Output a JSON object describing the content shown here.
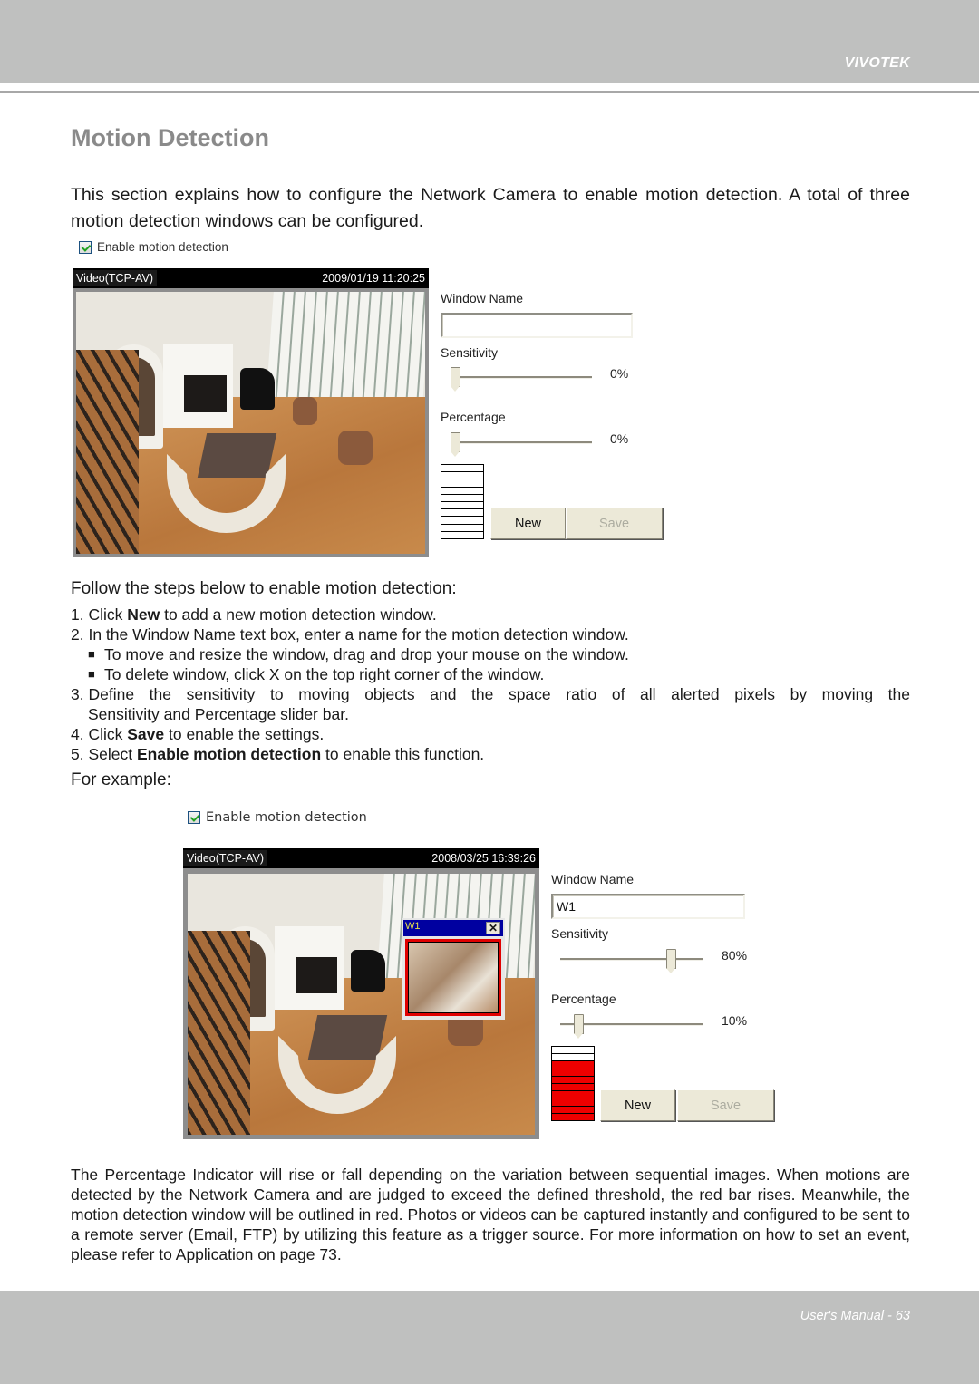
{
  "header": {
    "brand": "VIVOTEK"
  },
  "page": {
    "title": "Motion Detection",
    "intro": "This section explains how to configure the Network Camera to enable motion detection. A total of three motion detection windows can be configured."
  },
  "screenshot1": {
    "enable_checkbox": {
      "label": "Enable motion detection",
      "checked": true
    },
    "video": {
      "source_label": "Video(TCP-AV)",
      "timestamp": "2009/01/19 11:20:25"
    },
    "window_name_label": "Window Name",
    "window_name_value": "",
    "sensitivity_label": "Sensitivity",
    "sensitivity_value": "0%",
    "sensitivity_fraction": 0.0,
    "percentage_label": "Percentage",
    "percentage_value": "0%",
    "percentage_fraction": 0.0,
    "indicator_segments_total": 10,
    "indicator_segments_filled": 0,
    "new_button": "New",
    "save_button": "Save"
  },
  "steps": {
    "lead": "Follow the steps below to enable motion detection:",
    "items": [
      {
        "num": "1. ",
        "pre": "Click ",
        "bold": "New",
        "post": " to add a new motion detection window."
      },
      {
        "num": "2. ",
        "pre": "In the Window Name text box, enter a name for the motion detection window.",
        "bold": "",
        "post": ""
      },
      {
        "num": "3. ",
        "pre": "Define the sensitivity to moving objects and the space ratio of all alerted pixels by moving the",
        "bold": "",
        "post": ""
      },
      {
        "num": "4. ",
        "pre": "Click ",
        "bold": "Save",
        "post": " to enable the settings."
      },
      {
        "num": "5. ",
        "pre": "Select ",
        "bold": "Enable motion detection",
        "post": " to enable this function."
      }
    ],
    "sub_bullets": [
      "To move and resize the window, drag and drop your mouse on the window.",
      "To delete window, click X on the top right corner of the window."
    ],
    "step3_continuation": "Sensitivity and Percentage slider bar.",
    "bullet_glyph": "■"
  },
  "for_example": "For example:",
  "screenshot2": {
    "enable_checkbox": {
      "label": "Enable motion detection",
      "checked": true
    },
    "video": {
      "source_label": "Video(TCP-AV)",
      "timestamp": "2008/03/25 16:39:26"
    },
    "motion_window": {
      "title": "W1",
      "close_glyph": "✕",
      "outline_color": "#e00000"
    },
    "window_name_label": "Window Name",
    "window_name_value": "W1",
    "sensitivity_label": "Sensitivity",
    "sensitivity_value": "80%",
    "sensitivity_fraction": 0.8,
    "percentage_label": "Percentage",
    "percentage_value": "10%",
    "percentage_fraction": 0.1,
    "indicator_segments_total": 10,
    "indicator_segments_filled": 8,
    "indicator_color": "#ee0000",
    "new_button": "New",
    "save_button": "Save"
  },
  "outro": "The Percentage Indicator will rise or fall depending on the variation between sequential images. When motions are detected by the Network Camera and are judged to exceed the defined threshold, the red bar rises. Meanwhile, the motion detection window will be outlined in red. Photos or videos can be captured instantly and configured to be sent to a remote server (Email, FTP) by utilizing this feature as a trigger source. For more information on how to set an event, please refer to Application on page 73.",
  "footer": {
    "text": "User's Manual - 63"
  }
}
